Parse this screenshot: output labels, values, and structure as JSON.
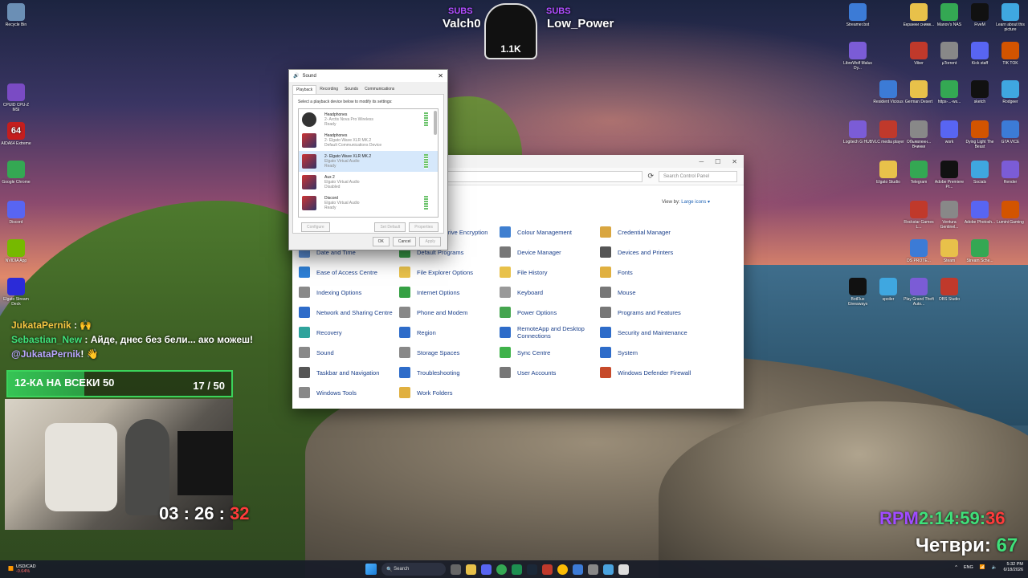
{
  "desktop_left_icons": [
    {
      "label": "Recycle Bin",
      "icon": "recycle-bin-icon"
    },
    {
      "label": "CPUID CPU-Z MSI",
      "icon": "cpuz-icon"
    },
    {
      "label": "AIDA64 Extreme",
      "icon": "aida64-icon",
      "glyph": "64"
    },
    {
      "label": "Google Chrome",
      "icon": "chrome-icon"
    },
    {
      "label": "Discord",
      "icon": "discord-icon"
    },
    {
      "label": "NVIDIA App",
      "icon": "nvidia-icon"
    },
    {
      "label": "Elgato Stream Deck",
      "icon": "streamdeck-icon"
    }
  ],
  "desktop_right_icons": [
    {
      "label": "Streamer.bot"
    },
    {
      "label": "Екранни снимк..."
    },
    {
      "label": "Manov's NAS"
    },
    {
      "label": "FiveM"
    },
    {
      "label": "Learn about this picture"
    },
    {
      "label": "LibreWolf Malus Dy..."
    },
    {
      "label": "Viber"
    },
    {
      "label": "µTorrent"
    },
    {
      "label": "Kick staff"
    },
    {
      "label": "TIK TOK"
    },
    {
      "label": "Resident Vicious"
    },
    {
      "label": "German Desert"
    },
    {
      "label": "https-...-ws..."
    },
    {
      "label": "sketch"
    },
    {
      "label": "Rodgeer"
    },
    {
      "label": "Logitech G HUB"
    },
    {
      "label": "VLC media player"
    },
    {
      "label": "Объявленн... Вчинки"
    },
    {
      "label": "work"
    },
    {
      "label": "Dying Light The Beast"
    },
    {
      "label": "GTA VICE"
    },
    {
      "label": "Elgato Studio"
    },
    {
      "label": "Telegram"
    },
    {
      "label": "Adobe Premiere Pr..."
    },
    {
      "label": "Socials"
    },
    {
      "label": "Render"
    },
    {
      "label": "Rockstar Games L..."
    },
    {
      "label": "Ventura Gentinel..."
    },
    {
      "label": "Adobe Photosh..."
    },
    {
      "label": "Lumini Gaming"
    },
    {
      "label": "DS PROTE..."
    },
    {
      "label": "Steam"
    },
    {
      "label": "Stream Sche..."
    },
    {
      "label": "BotFlux Giveaways"
    },
    {
      "label": "spoiler"
    },
    {
      "label": "Play Grand Theft Auto..."
    },
    {
      "label": "OBS Studio"
    }
  ],
  "overlay": {
    "subs_left_tag": "SUBS",
    "subs_left_name": "Valch0",
    "subs_right_tag": "SUBS",
    "subs_right_name": "Low_Power",
    "mascot_count": "1.1K",
    "chat": [
      {
        "user": "JukataPernik",
        "sep": " :",
        "msg": " 🙌"
      },
      {
        "user": "Sebastian_New",
        "sep": " :",
        "msg": " Айде, днес без бели... ако можеш!"
      },
      {
        "user": "@JukataPernik",
        "sep": "!",
        "msg": " 👋"
      }
    ],
    "goal_label": "12-КА НА ВСЕКИ 50",
    "goal_count": "17 / 50",
    "goal_progress": 0.34,
    "timer_main": "03 : 26 :",
    "timer_sec": "32",
    "rpm_label": "RPM",
    "rpm_time": "2:14:59:",
    "rpm_sec": "36",
    "thursday_label": "Четври:",
    "thursday_value": "67"
  },
  "control_panel": {
    "search_placeholder": "Search Control Panel",
    "address": "ns",
    "view_by_label": "View by:",
    "view_by_value": "Large icons ▾",
    "items": [
      {
        "label": "Backup and Restore",
        "color": "#4caf50"
      },
      {
        "label": "BitLocker Drive Encryption",
        "color": "#888"
      },
      {
        "label": "Colour Management",
        "color": "#3f7fd0"
      },
      {
        "label": "Credential Manager",
        "color": "#d9a640"
      },
      {
        "label": "Date and Time",
        "color": "#5a8fd8"
      },
      {
        "label": "Default Programs",
        "color": "#3aa34a"
      },
      {
        "label": "Device Manager",
        "color": "#777"
      },
      {
        "label": "Devices and Printers",
        "color": "#555"
      },
      {
        "label": "Ease of Access Centre",
        "color": "#2d7fd6"
      },
      {
        "label": "File Explorer Options",
        "color": "#e8c14a"
      },
      {
        "label": "File History",
        "color": "#e8c14a"
      },
      {
        "label": "Fonts",
        "color": "#e0b040"
      },
      {
        "label": "Indexing Options",
        "color": "#888"
      },
      {
        "label": "Internet Options",
        "color": "#35a043"
      },
      {
        "label": "Keyboard",
        "color": "#999"
      },
      {
        "label": "Mouse",
        "color": "#777"
      },
      {
        "label": "Network and Sharing Centre",
        "color": "#2e6cc9"
      },
      {
        "label": "Phone and Modem",
        "color": "#888"
      },
      {
        "label": "Power Options",
        "color": "#45a54f"
      },
      {
        "label": "Programs and Features",
        "color": "#777"
      },
      {
        "label": "Recovery",
        "color": "#2fa39c"
      },
      {
        "label": "Region",
        "color": "#2e6cc9"
      },
      {
        "label": "RemoteApp and Desktop Connections",
        "color": "#2e6cc9"
      },
      {
        "label": "Security and Maintenance",
        "color": "#2e6cc9"
      },
      {
        "label": "Sound",
        "color": "#888"
      },
      {
        "label": "Storage Spaces",
        "color": "#888"
      },
      {
        "label": "Sync Centre",
        "color": "#3fb24a"
      },
      {
        "label": "System",
        "color": "#2e6cc9"
      },
      {
        "label": "Taskbar and Navigation",
        "color": "#555"
      },
      {
        "label": "Troubleshooting",
        "color": "#2e6cc9"
      },
      {
        "label": "User Accounts",
        "color": "#777"
      },
      {
        "label": "Windows Defender Firewall",
        "color": "#c64a2a"
      },
      {
        "label": "Windows Tools",
        "color": "#888"
      },
      {
        "label": "Work Folders",
        "color": "#e0b040"
      }
    ]
  },
  "sound_dialog": {
    "title": "Sound",
    "close": "✕",
    "tabs": [
      "Playback",
      "Recording",
      "Sounds",
      "Communications"
    ],
    "instruction": "Select a playback device below to modify its settings:",
    "devices": [
      {
        "name": "Headphones",
        "desc": "2- Arctis Nova Pro Wireless",
        "status": "Ready",
        "type": "headphones",
        "selected": false,
        "level": true
      },
      {
        "name": "Headphones",
        "desc": "2- Elgato Wave XLR MK.2",
        "status": "Default Communications Device",
        "type": "speaker",
        "selected": false,
        "level": false
      },
      {
        "name": "2- Elgato Wave XLR MK.2",
        "desc": "Elgato Virtual Audio",
        "status": "Ready",
        "type": "speaker",
        "selected": true,
        "level": true
      },
      {
        "name": "Aux 2",
        "desc": "Elgato Virtual Audio",
        "status": "Disabled",
        "type": "speaker",
        "selected": false,
        "level": false
      },
      {
        "name": "Discord",
        "desc": "Elgato Virtual Audio",
        "status": "Ready",
        "type": "speaker",
        "selected": false,
        "level": true
      }
    ],
    "configure": "Configure",
    "set_default": "Set Default",
    "properties": "Properties",
    "ok": "OK",
    "cancel": "Cancel",
    "apply": "Apply"
  },
  "taskbar": {
    "ticker_symbol": "USD/CAD",
    "ticker_change": "-0.64%",
    "search_label": "Search",
    "lang": "ENG",
    "time": "5:32 PM",
    "date": "6/18/2026"
  }
}
